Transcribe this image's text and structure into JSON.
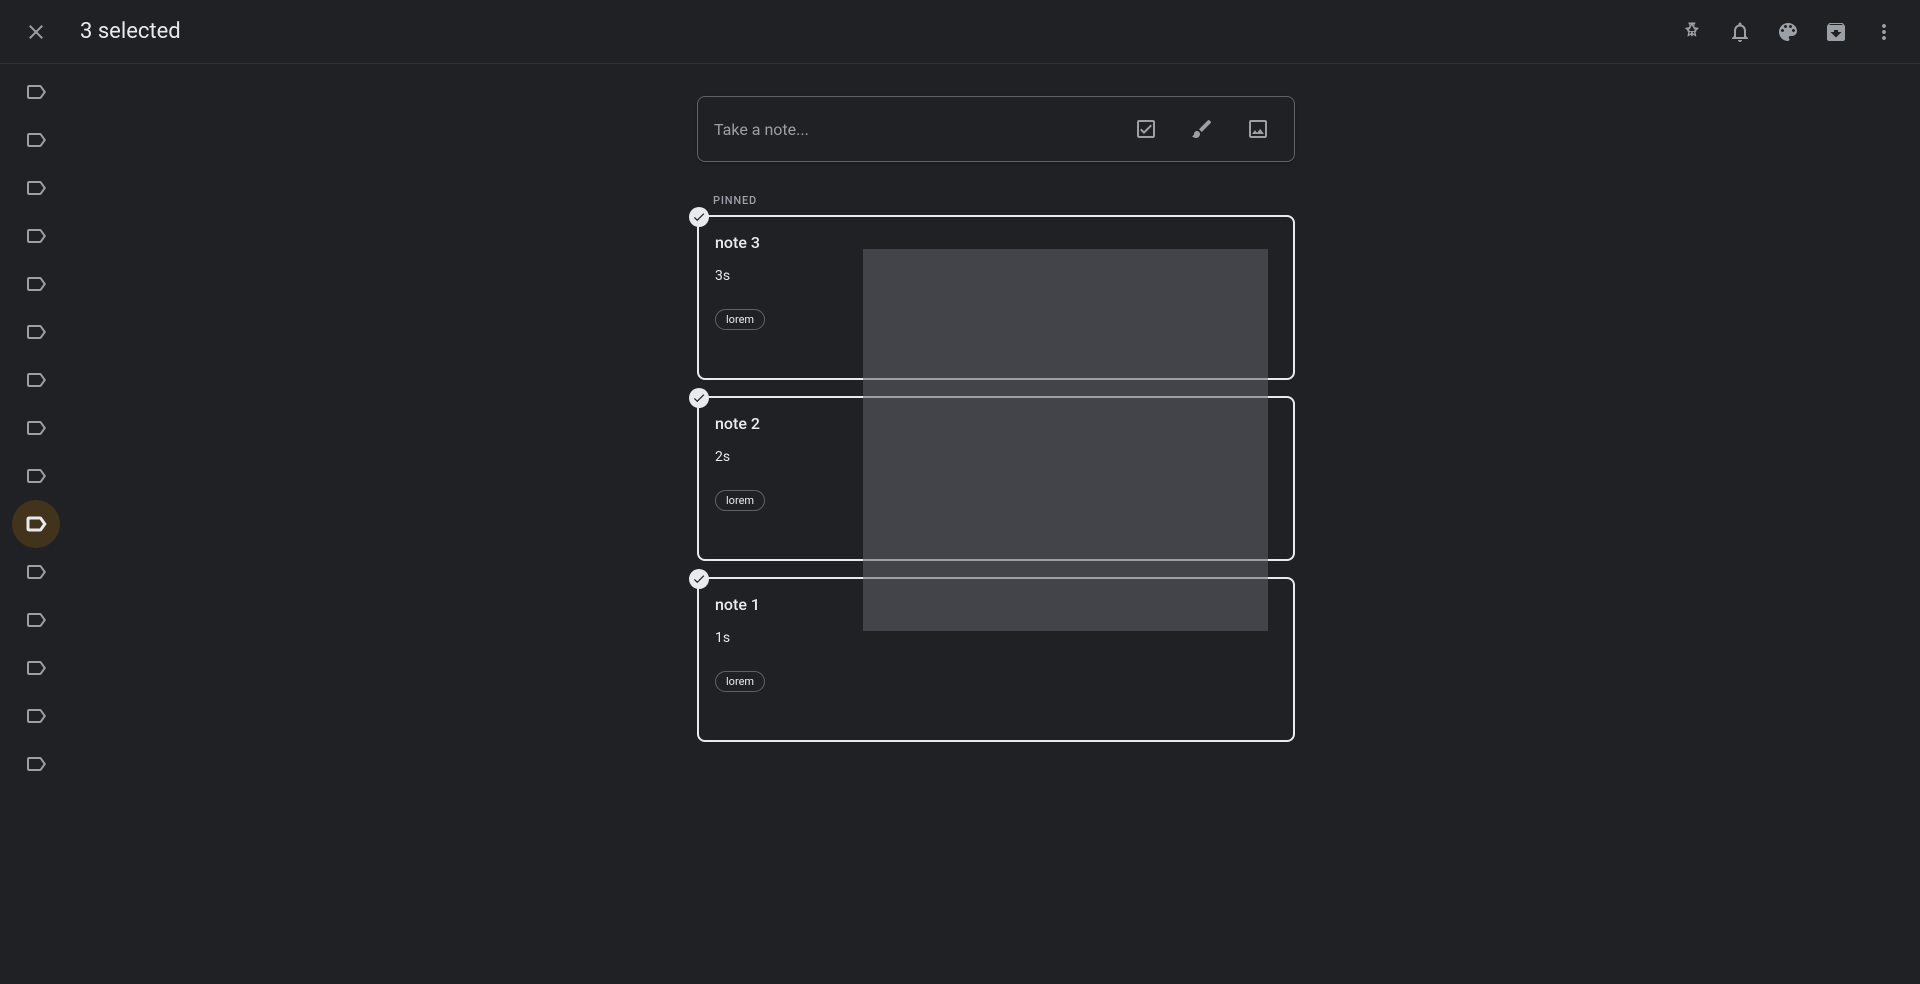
{
  "header": {
    "selection_text": "3 selected"
  },
  "sidebar": {
    "items": [
      {
        "active": false
      },
      {
        "active": false
      },
      {
        "active": false
      },
      {
        "active": false
      },
      {
        "active": false
      },
      {
        "active": false
      },
      {
        "active": false
      },
      {
        "active": false
      },
      {
        "active": false
      },
      {
        "active": true
      },
      {
        "active": false
      },
      {
        "active": false
      },
      {
        "active": false
      },
      {
        "active": false
      },
      {
        "active": false
      }
    ]
  },
  "compose": {
    "placeholder": "Take a note..."
  },
  "section_label": "PINNED",
  "notes": [
    {
      "title": "note 3",
      "body": "3s",
      "label": "lorem"
    },
    {
      "title": "note 2",
      "body": "2s",
      "label": "lorem"
    },
    {
      "title": "note 1",
      "body": "1s",
      "label": "lorem"
    }
  ]
}
